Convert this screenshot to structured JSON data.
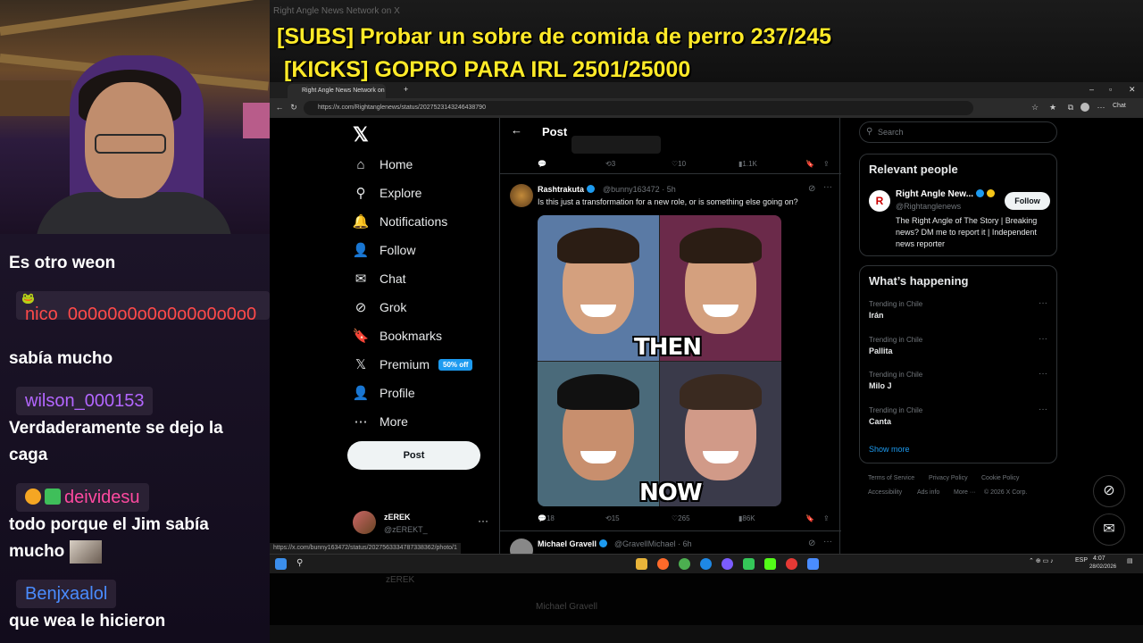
{
  "overlay": {
    "line1": "[SUBS] Probar un sobre de comida de perro 237/245",
    "line2": "[KICKS] GOPRO PARA IRL 2501/25000",
    "bg_tab": "Right Angle News Network on X"
  },
  "chat": [
    {
      "user": "",
      "msg": "Es otro weon"
    },
    {
      "user": "nico_0o0o0o0o0o0o0o0o0o0",
      "user_color": "#ff4a4a",
      "msg": "sabía mucho"
    },
    {
      "user": "wilson_000153",
      "user_color": "#b366ff",
      "msg": "Verdaderamente se dejo la caga"
    },
    {
      "user": "deividesu",
      "user_color": "#ff4aa0",
      "msg": "todo porque el Jim sabía mucho"
    },
    {
      "user": "Benjxaalol",
      "user_color": "#4a8cff",
      "msg": "que wea le hicieron"
    }
  ],
  "browser": {
    "tab_title": "Right Angle News Network on X",
    "url": "https://x.com/Rightanglenews/status/2027523143246438790",
    "chat_label": "Chat",
    "status_url": "https://x.com/bunny163472/status/2027563334787338362/photo/1"
  },
  "nav": {
    "items": [
      {
        "label": "Home",
        "icon": "home-icon",
        "glyph": "⌂"
      },
      {
        "label": "Explore",
        "icon": "search-icon",
        "glyph": "⚲"
      },
      {
        "label": "Notifications",
        "icon": "bell-icon",
        "glyph": "🔔"
      },
      {
        "label": "Follow",
        "icon": "person-plus-icon",
        "glyph": "👤"
      },
      {
        "label": "Chat",
        "icon": "mail-icon",
        "glyph": "✉"
      },
      {
        "label": "Grok",
        "icon": "grok-icon",
        "glyph": "⊘"
      },
      {
        "label": "Bookmarks",
        "icon": "bookmark-icon",
        "glyph": "🔖"
      },
      {
        "label": "Premium",
        "icon": "x-icon",
        "glyph": "𝕏"
      },
      {
        "label": "Profile",
        "icon": "person-icon",
        "glyph": "👤"
      },
      {
        "label": "More",
        "icon": "more-circle-icon",
        "glyph": "⋯"
      }
    ],
    "premium_badge": "50% off",
    "post_button": "Post",
    "account_name": "zEREK",
    "account_handle": "@zEREKT_"
  },
  "timeline": {
    "header": "Post",
    "prev_actions": {
      "replies": "",
      "reposts": "3",
      "likes": "10",
      "views": "1.1K"
    },
    "tweet": {
      "name": "Rashtrakuta",
      "handle": "@bunny163472 · 5h",
      "text": "Is this just a transformation for a new role, or is something else going on?",
      "then_label": "THEN",
      "now_label": "NOW",
      "replies": "18",
      "reposts": "15",
      "likes": "265",
      "views": "86K"
    },
    "next_tweet": {
      "name": "Michael Gravell",
      "handle": "@GravellMichael · 6h"
    }
  },
  "right": {
    "search_placeholder": "Search",
    "relevant_title": "Relevant people",
    "person": {
      "name": "Right Angle New...",
      "handle": "@Rightanglenews",
      "bio": "The Right Angle of The Story | Breaking news? DM me to report it | Independent news reporter",
      "follow": "Follow"
    },
    "happening_title": "What’s happening",
    "trends": [
      {
        "category": "Trending in Chile",
        "name": "Irán"
      },
      {
        "category": "Trending in Chile",
        "name": "Pallita"
      },
      {
        "category": "Trending in Chile",
        "name": "Milo J"
      },
      {
        "category": "Trending in Chile",
        "name": "Canta"
      }
    ],
    "show_more": "Show more",
    "footer": [
      "Terms of Service",
      "Privacy Policy",
      "Cookie Policy",
      "Accessibility",
      "Ads info",
      "More ···",
      "© 2026 X Corp."
    ]
  },
  "taskbar": {
    "lang": "ESP",
    "time": "4:07",
    "date": "28/02/2026"
  },
  "colors": {
    "accent": "#1d9bf0",
    "overlay_text": "#ffea28",
    "background": "#000000"
  }
}
